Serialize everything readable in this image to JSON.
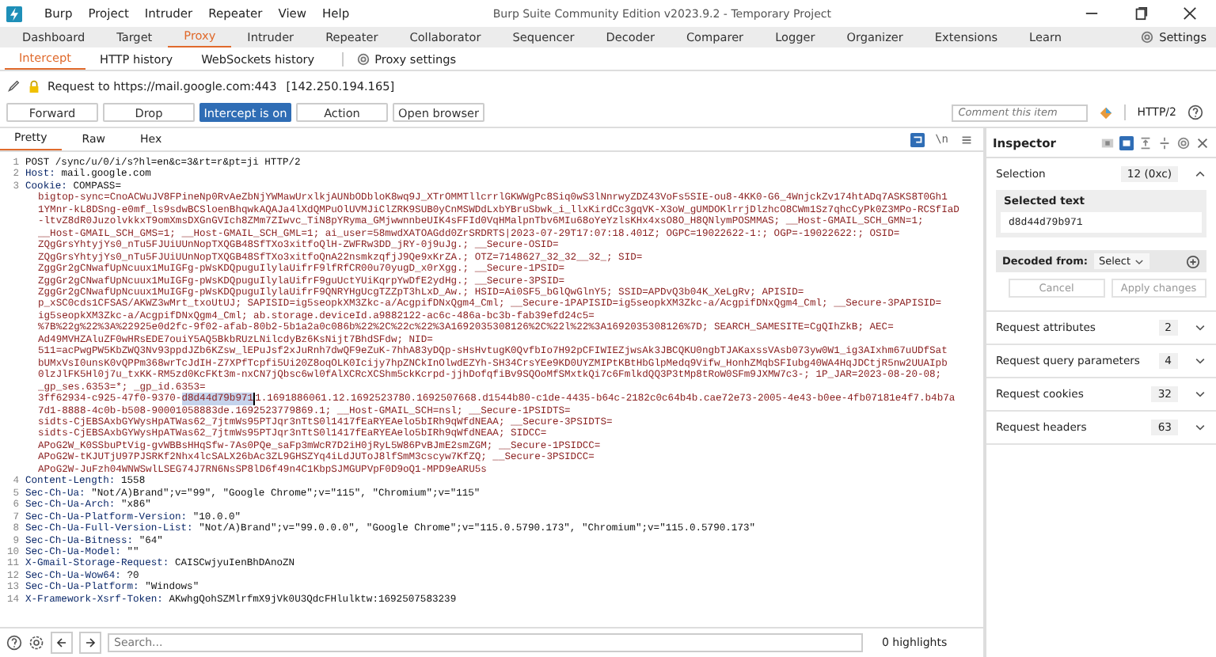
{
  "window": {
    "title": "Burp Suite Community Edition v2023.9.2 - Temporary Project"
  },
  "menu": [
    "Burp",
    "Project",
    "Intruder",
    "Repeater",
    "View",
    "Help"
  ],
  "tabs": [
    {
      "label": "Dashboard",
      "selected": false
    },
    {
      "label": "Target",
      "selected": false
    },
    {
      "label": "Proxy",
      "selected": true
    },
    {
      "label": "Intruder",
      "selected": false
    },
    {
      "label": "Repeater",
      "selected": false
    },
    {
      "label": "Collaborator",
      "selected": false
    },
    {
      "label": "Sequencer",
      "selected": false
    },
    {
      "label": "Decoder",
      "selected": false
    },
    {
      "label": "Comparer",
      "selected": false
    },
    {
      "label": "Logger",
      "selected": false
    },
    {
      "label": "Organizer",
      "selected": false
    },
    {
      "label": "Extensions",
      "selected": false
    },
    {
      "label": "Learn",
      "selected": false
    }
  ],
  "settings": "Settings",
  "subtabs": [
    {
      "label": "Intercept",
      "selected": true
    },
    {
      "label": "HTTP history",
      "selected": false
    },
    {
      "label": "WebSockets history",
      "selected": false
    }
  ],
  "proxy_settings": "Proxy settings",
  "request_info": {
    "text": "Request to https://mail.google.com:443",
    "ip": "[142.250.194.165]"
  },
  "buttons": [
    {
      "label": "Forward",
      "selected": false
    },
    {
      "label": "Drop",
      "selected": false
    },
    {
      "label": "Intercept is on",
      "selected": true
    },
    {
      "label": "Action",
      "selected": false
    },
    {
      "label": "Open browser",
      "selected": false
    }
  ],
  "comment": {
    "placeholder": "Comment this item"
  },
  "protocol": "HTTP/2",
  "editor_tabs": [
    {
      "label": "Pretty",
      "selected": true
    },
    {
      "label": "Raw",
      "selected": false
    },
    {
      "label": "Hex",
      "selected": false
    }
  ],
  "newline_glyph": "\\n",
  "lines": [
    {
      "number": "1",
      "value": "POST /sync/u/0/i/s?hl=en&c=3&rt=r&pt=ji HTTP/2"
    },
    {
      "number": "2",
      "name": "Host:",
      "value": "mail.google.com"
    },
    {
      "number": "3",
      "name": "Cookie:",
      "value": "COMPASS=",
      "wrapped": [
        {
          "text": "bigtop-sync=CnoACWuJV8FPineNp0RvAeZbNjYWMawUrxlkjAUNbODbloK8wq9J_XTrOMMTllcrrlGKWWgPc8Siq0wS3lNnrwyZDZ43VoFs5SIE-ou8-4KK0-G6_4WnjckZv174htADq7ASKS8T0Gh1"
        },
        {
          "text": "1YMnr-kL8DSng-e0mf_ls9sdwBCSloenBhqwkAQAJa4lXdQMPuOlUVMJiClZRK9SUB0yCnMSWDdLxbYBruSbwk_i_llxKirdCc3gqVK-X3oW_gUMDOKlrrjDlzhcO8CWm1Sz7qhcCyPk0Z3MPo-RCSfIaD"
        },
        {
          "text": "-ltvZ8dR0JuzolvkkxT9omXmsDXGnGVIch8ZMm7ZIwvc_TiN8pYRyma_GMjwwnnbeUIK4sFFId0VqHMalpnTbv6MIu68oYeYzlsKHx4xsO8O_H8QNlymPOSMMAS; __Host-GMAIL_SCH_GMN=1;"
        },
        {
          "text": "__Host-GMAIL_SCH_GMS=1; __Host-GMAIL_SCH_GML=1; ai_user=58mwdXATOAGdd0ZrSRDRTS|2023-07-29T17:07:18.401Z; OGPC=19022622-1:; OGP=-19022622:; OSID="
        },
        {
          "text": "ZQgGrsYhtyjYs0_nTu5FJUiUUnNopTXQGB48SfTXo3xitfoQlH-ZWFRw3DD_jRY-0j9uJg.; __Secure-OSID="
        },
        {
          "text": "ZQgGrsYhtyjYs0_nTu5FJUiUUnNopTXQGB48SfTXo3xitfoQnA22nsmkzqfjJ9Qe9xKrZA.; OTZ=7148627_32_32__32_; SID="
        },
        {
          "text": "ZggGr2gCNwafUpNcuux1MuIGFg-pWsKDQpuguIlylaUifrF9lfRfCR00u70yugD_x0rXgg.; __Secure-1PSID="
        },
        {
          "text": "ZggGr2gCNwafUpNcuux1MuIGFg-pWsKDQpuguIlylaUifrF9guUctYUiKqrpYwDfE2ydHg.; __Secure-3PSID="
        },
        {
          "text": "ZggGr2gCNwafUpNcuux1MuIGFg-pWsKDQpuguIlylaUifrF9QNRYHgUcgTZZpT3hLxD_Aw.; HSID=Ai0SF5_bGlQwGlnY5; SSID=APDvQ3b04K_XeLgRv; APISID="
        },
        {
          "text": "p_xSC0cds1CFSAS/AKWZ3wMrt_txoUtUJ; SAPISID=ig5seopkXM3Zkc-a/AcgpifDNxQgm4_Cml; __Secure-1PAPISID=ig5seopkXM3Zkc-a/AcgpifDNxQgm4_Cml; __Secure-3PAPISID="
        },
        {
          "text": "ig5seopkXM3Zkc-a/AcgpifDNxQgm4_Cml; ab.storage.deviceId.a9882122-ac6c-486a-bc3b-fab39efd24c5="
        },
        {
          "text": "%7B%22g%22%3A%22925e0d2fc-9f02-afab-80b2-5b1a2a0c086b%22%2C%22c%22%3A1692035308126%2C%22l%22%3A1692035308126%7D; SEARCH_SAMESITE=CgQIhZkB; AEC="
        },
        {
          "text": "Ad49MVHZAluZF0wHRsEDE7ouiY5AQ5BkbRUzLNilcdyBz6KsNijt7BhdSFdw; NID="
        },
        {
          "text": "511=acPwgPW5KbZWQ3Nv93ppdJZb6KZsw_lEPuJsf2xJuRnh7dwQF9eZuK-7hhA83yDQp-sHsHvtugK0QvfbIo7H92pCFIWIEZjwsAk3JBCQKU0ngbTJAKaxssVAsb073yw0W1_ig3AIxhm67uUDfSat"
        },
        {
          "text": "bUMxVsI0unsK0vQPPm368wrTcJdIH-Z7XPfTcpfi5Ui20Z8oqOLK0Icijy7hpZNCkInOlwdEZYh-SH34CrsYEe9KD0UYZMIPtKBtHbGlpMedq9Vifw_HonhZMqbSFIubg40WA4HqJDCtjR5nw2UUAIpb"
        },
        {
          "text": "0lzJlFK5Hl0j7u_txKK-RM5zd0KcFKt3m-nxCN7jQbsc6wl0fAlXCRcXCShm5ckKcrpd-jjhDofqfiBv9SQOoMfSMxtkQi7c6FmlkdQQ3P3tMp8tRoW0SFm9JXMW7c3-; 1P_JAR=2023-08-20-08;"
        },
        {
          "text": "_gp_ses.6353=*; _gp_id.6353="
        },
        {
          "text": "3ff62934-c925-47f0-9370-",
          "highlight": "d8d44d79b971",
          "after": "1.1691886061.12.1692523780.1692507668.d1544b80-c1de-4435-b64c-2182c0c64b4b.cae72e73-2005-4e43-b0ee-4fb07181e4f7.b4b7a"
        },
        {
          "text": "7d1-8888-4c0b-b508-90001058883de.1692523779869.1; __Host-GMAIL_SCH=nsl; __Secure-1PSIDTS="
        },
        {
          "text": "sidts-CjEBSAxbGYWysHpATWas62_7jtmWs95PTJqr3nTtS0l1417fEaRYEAelo5bIRh9qWfdNEAA; __Secure-3PSIDTS="
        },
        {
          "text": "sidts-CjEBSAxbGYWysHpATWas62_7jtmWs95PTJqr3nTtS0l1417fEaRYEAelo5bIRh9qWfdNEAA; SIDCC="
        },
        {
          "text": "APoG2W_K0SSbuPtVig-gvWBBsHHqSfw-7As0PQe_saFp3mWcR7D2iH0jRyL5W86PvBJmE2smZGM; __Secure-1PSIDCC="
        },
        {
          "text": "APoG2W-tKJUTjU97PJSRKf2Nhx4lcSALX26bAc3ZL9GHSZYq4iLdJUToJ8lfSmM3cscyw7KfZQ; __Secure-3PSIDCC="
        },
        {
          "text": "APoG2W-JuFzh04WNWSwlLSEG74J7RN6NsSP8lD6f49n4C1KbpSJMGUPVpF0D9oQ1-MPD9eARU5s"
        }
      ]
    },
    {
      "number": "4",
      "name": "Content-Length:",
      "value": "1558"
    },
    {
      "number": "5",
      "name": "Sec-Ch-Ua:",
      "value": "\"Not/A)Brand\";v=\"99\", \"Google Chrome\";v=\"115\", \"Chromium\";v=\"115\""
    },
    {
      "number": "6",
      "name": "Sec-Ch-Ua-Arch:",
      "value": "\"x86\""
    },
    {
      "number": "7",
      "name": "Sec-Ch-Ua-Platform-Version:",
      "value": "\"10.0.0\""
    },
    {
      "number": "8",
      "name": "Sec-Ch-Ua-Full-Version-List:",
      "value": "\"Not/A)Brand\";v=\"99.0.0.0\", \"Google Chrome\";v=\"115.0.5790.173\", \"Chromium\";v=\"115.0.5790.173\""
    },
    {
      "number": "9",
      "name": "Sec-Ch-Ua-Bitness:",
      "value": "\"64\""
    },
    {
      "number": "10",
      "name": "Sec-Ch-Ua-Model:",
      "value": "\"\""
    },
    {
      "number": "11",
      "name": "X-Gmail-Storage-Request:",
      "value": "CAISCwjyuIenBhDAnoZN"
    },
    {
      "number": "12",
      "name": "Sec-Ch-Ua-Wow64:",
      "value": "?0"
    },
    {
      "number": "13",
      "name": "Sec-Ch-Ua-Platform:",
      "value": "\"Windows\""
    },
    {
      "number": "14",
      "name": "X-Framework-Xsrf-Token:",
      "value": "AKwhgQohSZMlrfmX9jVk0U3QdcFHlulktw:1692507583239"
    }
  ],
  "search": {
    "placeholder": "Search..."
  },
  "highlights": "0 highlights",
  "inspector": {
    "title": "Inspector",
    "selection": {
      "label": "Selection",
      "value": "12 (0xc)",
      "expanded": true
    },
    "selected_text": {
      "label": "Selected text",
      "value": "d8d44d79b971"
    },
    "decoded_from": {
      "label": "Decoded from:",
      "select": "Select"
    },
    "actions": [
      {
        "label": "Cancel",
        "disabled": true
      },
      {
        "label": "Apply changes",
        "disabled": true
      }
    ],
    "sections": [
      {
        "label": "Request attributes",
        "count": "2",
        "expanded": false
      },
      {
        "label": "Request query parameters",
        "count": "4",
        "expanded": false
      },
      {
        "label": "Request cookies",
        "count": "32",
        "expanded": false
      },
      {
        "label": "Request headers",
        "count": "63",
        "expanded": false
      }
    ]
  }
}
